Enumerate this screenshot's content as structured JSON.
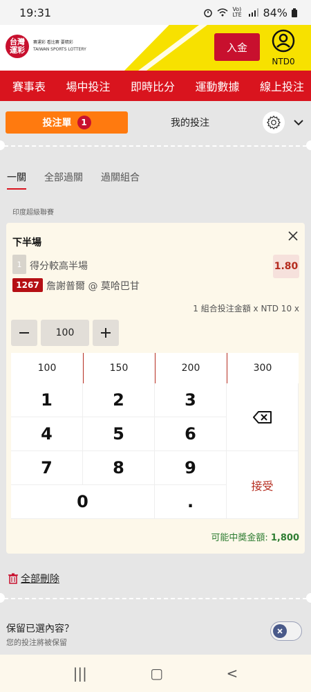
{
  "status_bar": {
    "time": "19:31",
    "battery": "84%",
    "indicator_icons": [
      "alarm-icon",
      "wifi-icon",
      "volte-icon",
      "signal-icon"
    ],
    "network_label": "Vo) LTE"
  },
  "header": {
    "logo_text_line1": "台灣",
    "logo_text_line2": "運彩",
    "logo_subtext": "賽運彩 看比賽 要精彩",
    "logo_english": "TAIWAN SPORTS LOTTERY",
    "deposit_label": "入金",
    "currency_label": "NTD0"
  },
  "main_nav": {
    "items": [
      "賽事表",
      "場中投注",
      "即時比分",
      "運動數據",
      "線上投注"
    ]
  },
  "bet_tabs": {
    "betslip_label": "投注單",
    "betslip_count": "1",
    "mybets_label": "我的投注"
  },
  "sub_tabs": {
    "items": [
      "一關",
      "全部過關",
      "過關組合"
    ],
    "active": "一關"
  },
  "league_name": "印度超級聯賽",
  "bet": {
    "market": "下半場",
    "selection_number": "1",
    "selection_name": "得分較高半場",
    "odds": "1.80",
    "match_code": "1267",
    "match_name": "詹謝普爾 @ 莫哈巴甘",
    "combo_info": "1 組合投注金額 x NTD 10 x",
    "stake": "100"
  },
  "keypad": {
    "presets": [
      "100",
      "150",
      "200",
      "300"
    ],
    "digits": [
      "1",
      "2",
      "3",
      "4",
      "5",
      "6",
      "7",
      "8",
      "9",
      "0",
      "."
    ],
    "accept_label": "接受"
  },
  "winnings": {
    "label": "可能中獎金額:",
    "value": "1,800"
  },
  "delete_all_label": "全部刪除",
  "keep_selections": {
    "title": "保留已選內容？",
    "subtitle": "您的投注將被保留",
    "enabled": false
  },
  "system_nav": {
    "recent": "|||",
    "home": "▢",
    "back": "<"
  },
  "colors": {
    "brand_red": "#d9141e",
    "orange": "#ff7a0f",
    "yellow": "#f7e100",
    "green": "#2e7d32"
  }
}
